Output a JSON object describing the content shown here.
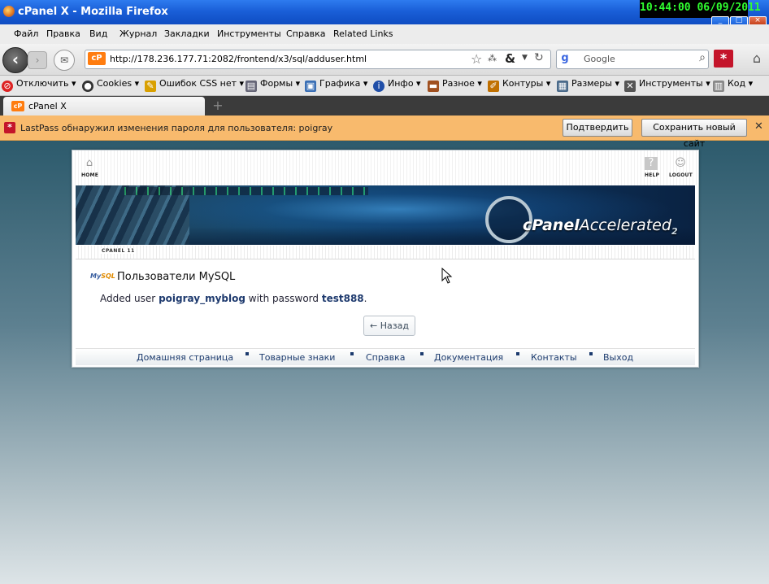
{
  "window": {
    "title": "cPanel X - Mozilla Firefox",
    "clock": "10:44:00  06/09/2011",
    "controls": [
      "_",
      "□",
      "×"
    ]
  },
  "menu": [
    "Файл",
    "Правка",
    "Вид",
    "Журнал",
    "Закладки",
    "Инструменты",
    "Справка",
    "Related Links"
  ],
  "nav": {
    "url": "http://178.236.177.71:2082/frontend/x3/sql/adduser.html",
    "search_placeholder": "Google",
    "favicon_text": "cP"
  },
  "bookmarks": [
    "Отключить",
    "Cookies",
    "Ошибок CSS нет",
    "Формы",
    "Графика",
    "Инфо",
    "Разное",
    "Контуры",
    "Размеры",
    "Инструменты",
    "Код"
  ],
  "tab": {
    "label": "cPanel X",
    "favicon_text": "cP"
  },
  "lastpass": {
    "message": "LastPass обнаружил изменения пароля для пользователя: poigray",
    "confirm_button": "Подтвердить",
    "save_new_button": "Сохранить новый сайт"
  },
  "cpanel": {
    "home_label": "HOME",
    "help_label": "HELP",
    "logout_label": "LOGOUT",
    "logo_text": "cPanel",
    "logo_text2": "Accelerated",
    "logo_sub": "2",
    "version_label": "CPANEL 11",
    "page_title": "Пользователи MySQL",
    "message_prefix": "Added user",
    "user": "poigray_myblog",
    "message_mid": "with password",
    "password": "test888",
    "message_suffix": ".",
    "back_button": "← Назад",
    "footer_links": [
      "Домашняя страница",
      "Товарные знаки",
      "Справка",
      "Документация",
      "Контакты",
      "Выход"
    ]
  }
}
